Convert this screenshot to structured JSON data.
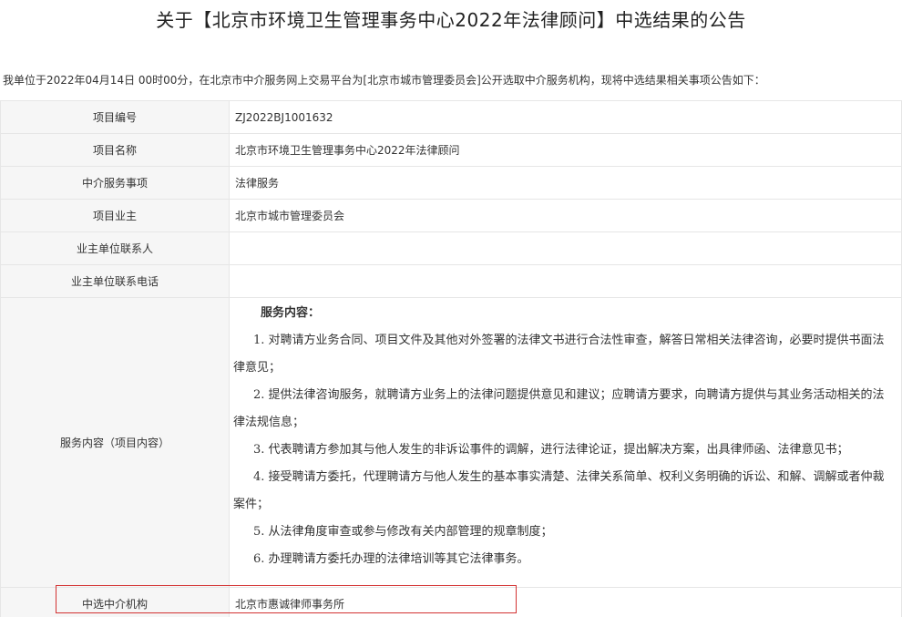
{
  "title": "关于【北京市环境卫生管理事务中心2022年法律顾问】中选结果的公告",
  "intro": "我单位于2022年04月14日 00时00分，在北京市中介服务网上交易平台为[北京市城市管理委员会]公开选取中介服务机构，现将中选结果相关事项公告如下：",
  "rows": [
    {
      "label": "项目编号",
      "value": "ZJ2022BJ1001632"
    },
    {
      "label": "项目名称",
      "value": "北京市环境卫生管理事务中心2022年法律顾问"
    },
    {
      "label": "中介服务事项",
      "value": "法律服务"
    },
    {
      "label": "项目业主",
      "value": "北京市城市管理委员会"
    },
    {
      "label": "业主单位联系人",
      "value": ""
    },
    {
      "label": "业主单位联系电话",
      "value": ""
    }
  ],
  "service": {
    "label": "服务内容（项目内容）",
    "heading": "服务内容：",
    "items": [
      "1. 对聘请方业务合同、项目文件及其他对外签署的法律文书进行合法性审查，解答日常相关法律咨询，必要时提供书面法律意见；",
      "2. 提供法律咨询服务，就聘请方业务上的法律问题提供意见和建议；应聘请方要求，向聘请方提供与其业务活动相关的法律法规信息；",
      "3. 代表聘请方参加其与他人发生的非诉讼事件的调解，进行法律论证，提出解决方案，出具律师函、法律意见书；",
      "4. 接受聘请方委托，代理聘请方与他人发生的基本事实清楚、法律关系简单、权利义务明确的诉讼、和解、调解或者仲裁案件；",
      "5. 从法律角度审查或参与修改有关内部管理的规章制度；",
      "6. 办理聘请方委托办理的法律培训等其它法律事务。"
    ]
  },
  "selected": {
    "label": "中选中介机构",
    "value": "北京市惠诚律师事务所"
  },
  "colors": {
    "highlight": "#d33232",
    "label_bg": "#f6f6f6",
    "border": "#e6e6e6"
  }
}
